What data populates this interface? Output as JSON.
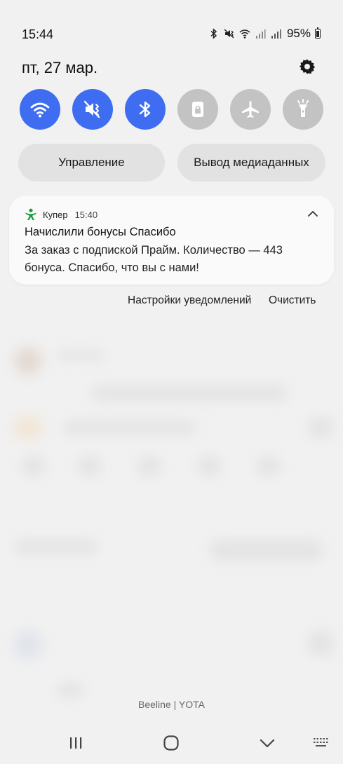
{
  "status_bar": {
    "time": "15:44",
    "battery_percent": "95%",
    "icons": [
      "bluetooth-icon",
      "mute-vibrate-icon",
      "wifi-icon",
      "signal-icon",
      "signal-icon",
      "battery-icon"
    ]
  },
  "header": {
    "date": "пт, 27 мар.",
    "settings_icon": "gear-icon"
  },
  "quick_toggles": [
    {
      "name": "wifi",
      "icon": "wifi-icon",
      "state": "on"
    },
    {
      "name": "sound",
      "icon": "mute-vibrate-icon",
      "state": "on"
    },
    {
      "name": "bluetooth",
      "icon": "bluetooth-icon",
      "state": "on"
    },
    {
      "name": "rotation-lock",
      "icon": "rotation-lock-icon",
      "state": "off"
    },
    {
      "name": "airplane",
      "icon": "airplane-icon",
      "state": "off"
    },
    {
      "name": "flashlight",
      "icon": "flashlight-icon",
      "state": "off"
    }
  ],
  "buttons": {
    "control_label": "Управление",
    "media_output_label": "Вывод медиаданных"
  },
  "notification": {
    "app_name": "Купер",
    "time": "15:40",
    "title": "Начислили бонусы Спасибо",
    "body": "За заказ с подпиской Прайм. Количество — 443 бонуса. Спасибо, что вы с нами!"
  },
  "notification_actions": {
    "settings_label": "Настройки уведомлений",
    "clear_label": "Очистить"
  },
  "carrier": "Beeline | YOTA",
  "colors": {
    "accent_on": "#3e6df2",
    "toggle_off": "#c3c3c3",
    "app_icon_green": "#1a9c3e"
  }
}
